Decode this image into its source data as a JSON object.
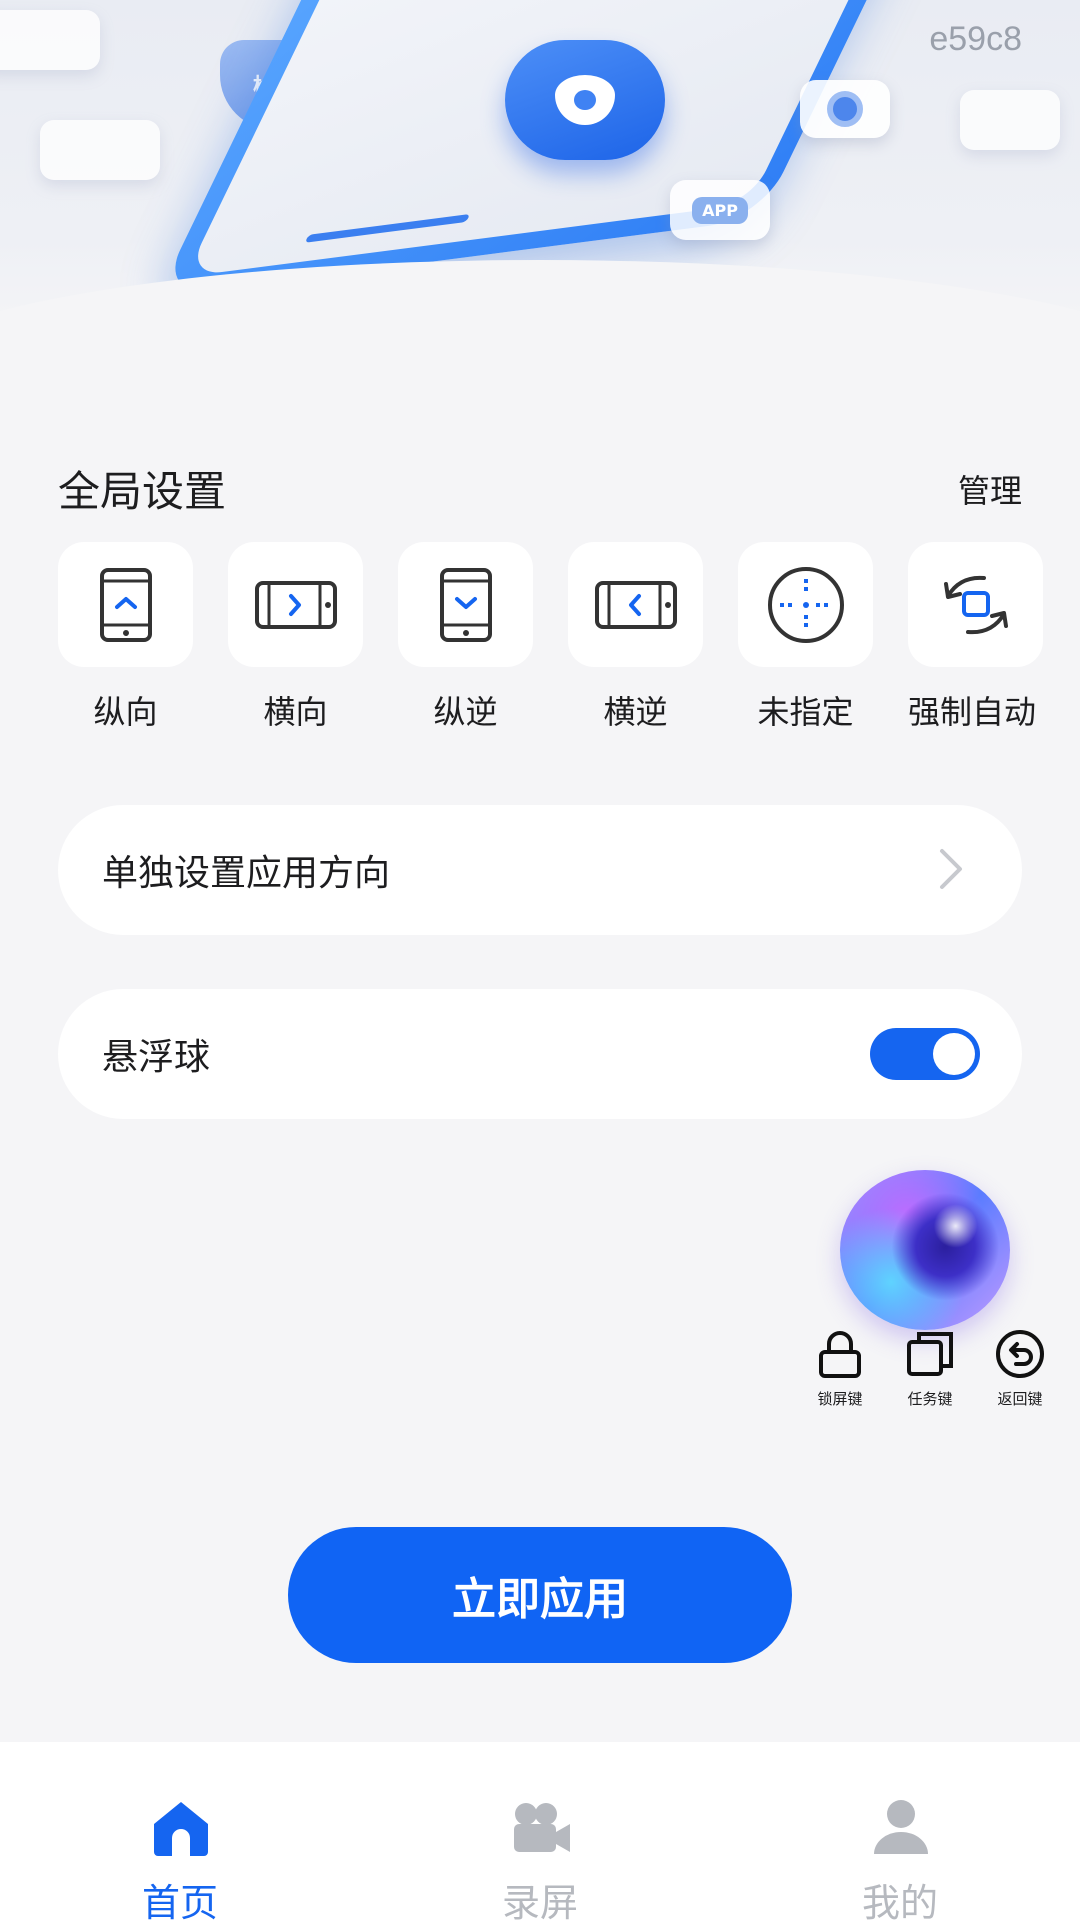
{
  "hero": {
    "watermark": "e59c8",
    "shield_badge_text": "检测",
    "app_chip_text": "APP"
  },
  "global_settings": {
    "title": "全局设置",
    "manage_label": "管理",
    "options": [
      {
        "label": "纵向",
        "icon": "portrait-icon"
      },
      {
        "label": "横向",
        "icon": "landscape-icon"
      },
      {
        "label": "纵逆",
        "icon": "reverse-portrait-icon"
      },
      {
        "label": "横逆",
        "icon": "reverse-landscape-icon"
      },
      {
        "label": "未指定",
        "icon": "unspecified-icon"
      },
      {
        "label": "强制自动",
        "icon": "force-auto-rotate-icon"
      }
    ]
  },
  "per_app_card": {
    "label": "单独设置应用方向"
  },
  "floating_ball_card": {
    "label": "悬浮球",
    "toggle_on": true
  },
  "quick_keys": [
    {
      "label": "锁屏键",
      "icon": "lock-icon"
    },
    {
      "label": "任务键",
      "icon": "task-switch-icon"
    },
    {
      "label": "返回键",
      "icon": "back-icon"
    }
  ],
  "apply_button": {
    "label": "立即应用"
  },
  "bottom_nav": [
    {
      "label": "首页",
      "icon": "home-icon",
      "active": true
    },
    {
      "label": "录屏",
      "icon": "video-camera-icon",
      "active": false
    },
    {
      "label": "我的",
      "icon": "user-icon",
      "active": false
    }
  ],
  "colors": {
    "accent": "#1565f0",
    "background": "#f5f5f7",
    "card": "#ffffff",
    "inactive": "#b6b9bf"
  }
}
